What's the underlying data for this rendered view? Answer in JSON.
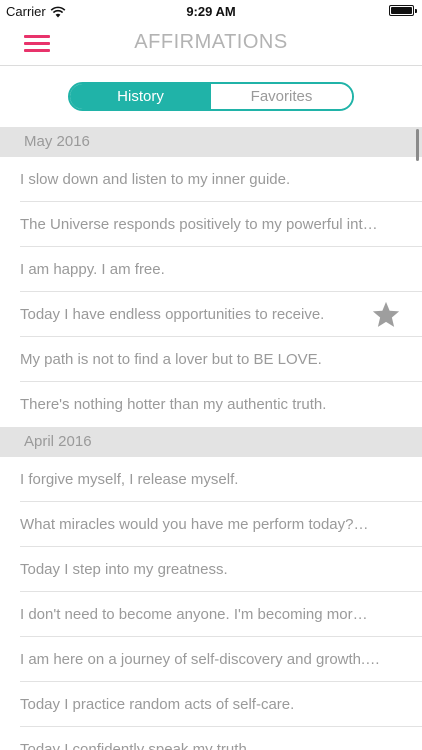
{
  "status_bar": {
    "carrier": "Carrier",
    "time": "9:29 AM"
  },
  "header": {
    "title": "AFFIRMATIONS",
    "menu_icon": "hamburger-menu-icon"
  },
  "tabs": [
    {
      "label": "History",
      "active": true
    },
    {
      "label": "Favorites",
      "active": false
    }
  ],
  "colors": {
    "accent": "#20b3a8",
    "menu": "#e8336b",
    "text": "#9a9a9a",
    "section_bg": "#e3e3e3"
  },
  "sections": [
    {
      "title": "May 2016",
      "items": [
        {
          "text": "I slow down and listen to my inner guide.",
          "favorite": false
        },
        {
          "text": "The Universe responds positively to my powerful int…",
          "favorite": false
        },
        {
          "text": "I am happy. I am free.",
          "favorite": false
        },
        {
          "text": "Today I have endless opportunities to receive.",
          "favorite": true
        },
        {
          "text": "My path is not to find a lover but to BE LOVE.",
          "favorite": false
        },
        {
          "text": "There's nothing hotter than my authentic truth.",
          "favorite": false
        }
      ]
    },
    {
      "title": "April 2016",
      "items": [
        {
          "text": "I forgive myself, I release myself.",
          "favorite": false
        },
        {
          "text": "What miracles would you have me perform today?…",
          "favorite": false
        },
        {
          "text": "Today I step into my greatness.",
          "favorite": false
        },
        {
          "text": "I don't need to become anyone. I'm becoming mor…",
          "favorite": false
        },
        {
          "text": "I am here on a journey of self-discovery and growth.…",
          "favorite": false
        },
        {
          "text": "Today I practice random acts of self-care.",
          "favorite": false
        },
        {
          "text": "Today I confidently speak my truth.",
          "favorite": false
        }
      ]
    }
  ]
}
